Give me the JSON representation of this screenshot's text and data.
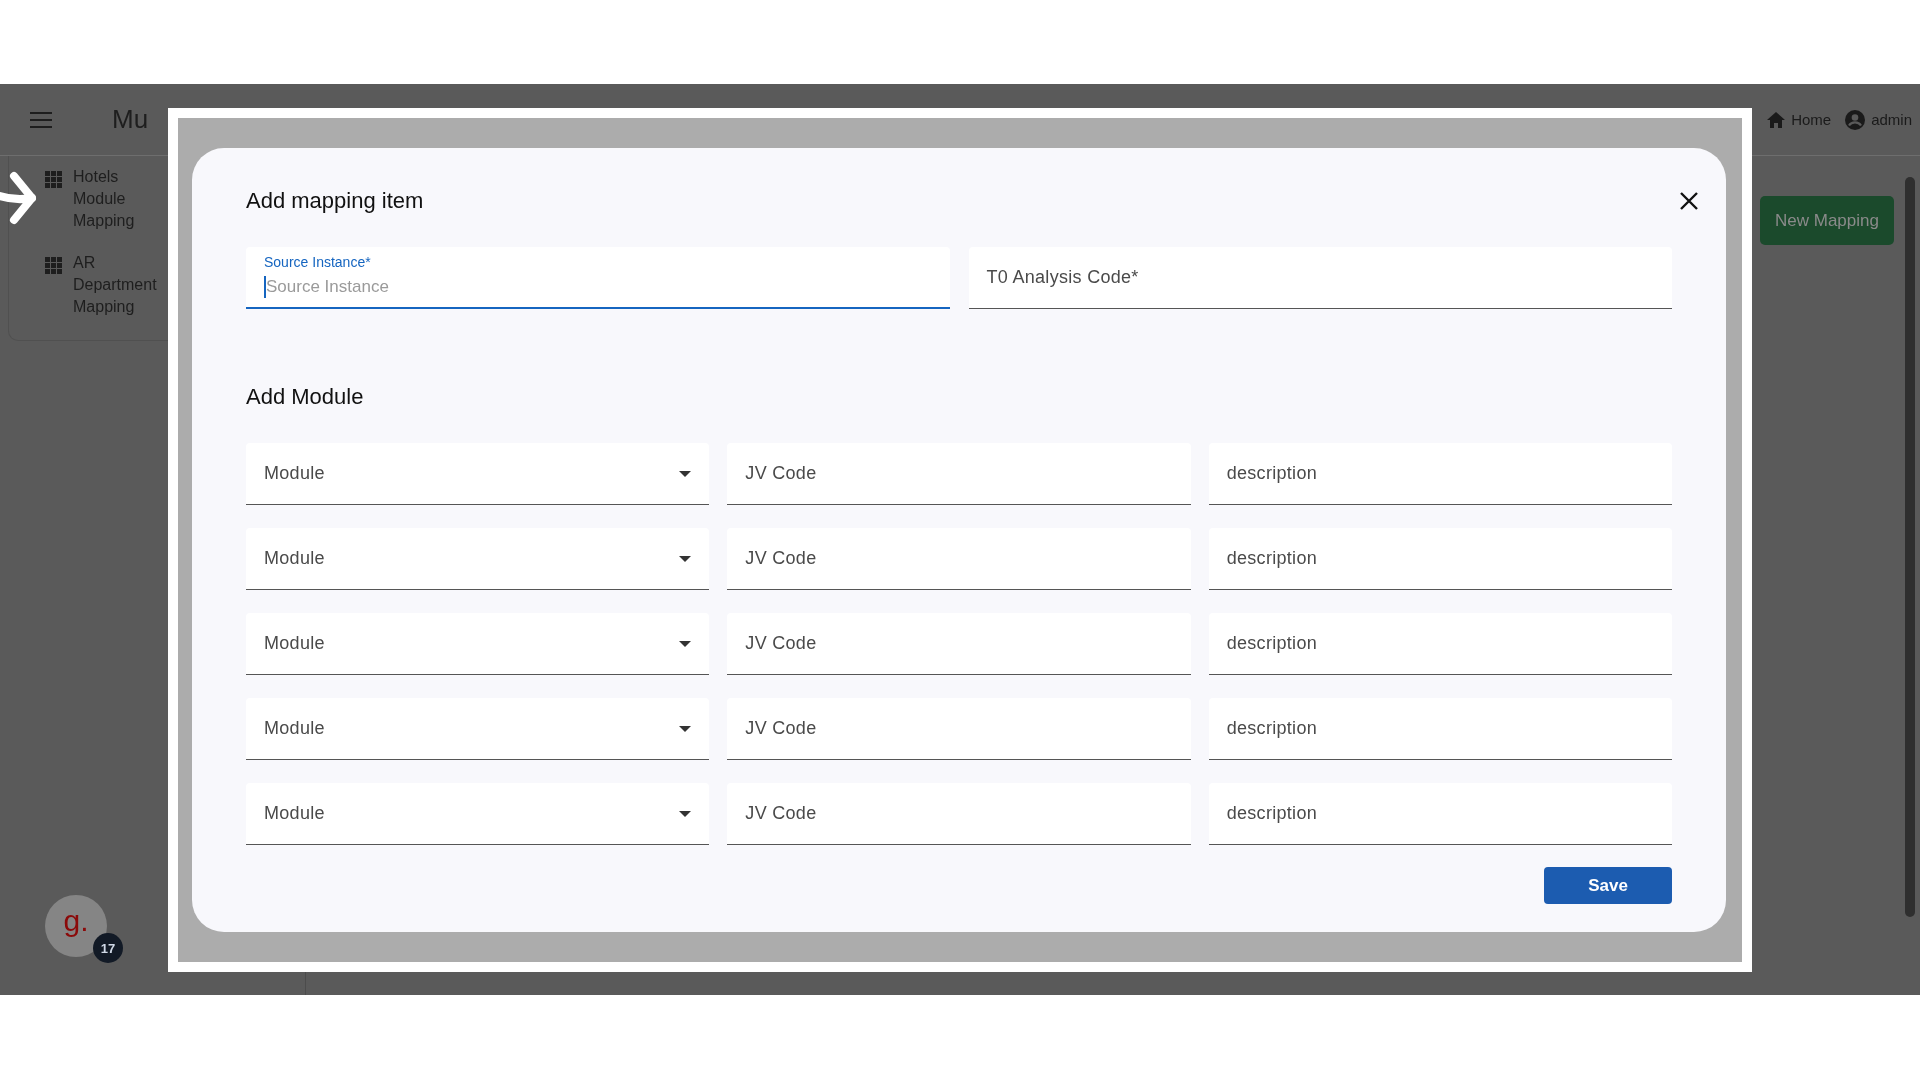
{
  "app": {
    "title": "Mu",
    "nav": [
      {
        "kind": "home",
        "label": "Home"
      },
      {
        "kind": "user",
        "label": "admin"
      }
    ],
    "sidebar": {
      "items": [
        {
          "label": "Hotels Module Mapping"
        },
        {
          "label": "AR Department Mapping"
        }
      ]
    },
    "new_button": "New Mapping",
    "chat_badge": {
      "logo": "g.",
      "count": "17"
    }
  },
  "dialog": {
    "title": "Add mapping item",
    "fields": [
      {
        "label": "Source Instance*",
        "placeholder": "Source Instance",
        "focused": true
      },
      {
        "label": "T0 Analysis Code*",
        "focused": false
      }
    ],
    "section_title": "Add Module",
    "rows": [
      {
        "module": "Module",
        "code": "JV Code",
        "description": "description"
      },
      {
        "module": "Module",
        "code": "JV Code",
        "description": "description"
      },
      {
        "module": "Module",
        "code": "JV Code",
        "description": "description"
      },
      {
        "module": "Module",
        "code": "JV Code",
        "description": "description"
      },
      {
        "module": "Module",
        "code": "JV Code",
        "description": "description"
      }
    ],
    "save": "Save"
  }
}
